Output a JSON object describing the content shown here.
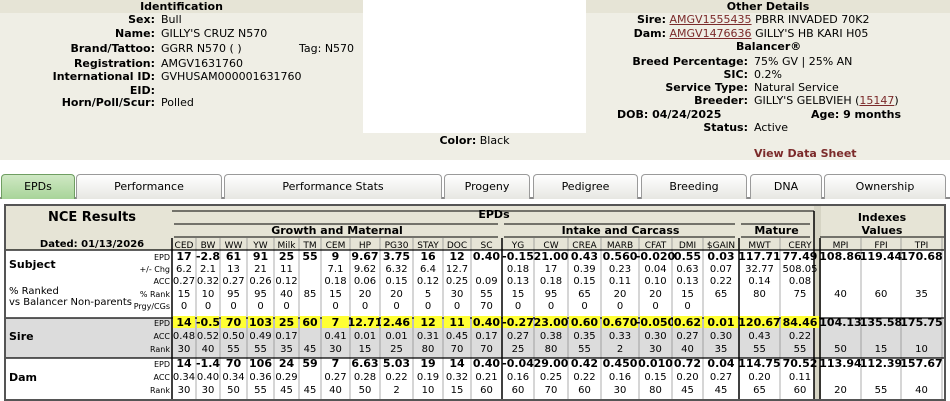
{
  "identification": {
    "title": "Identification",
    "rows": [
      {
        "label": "Sex:",
        "value": "Bull"
      },
      {
        "label": "Name:",
        "value": "GILLY'S CRUZ N570"
      },
      {
        "label": "Brand/Tattoo:",
        "value": "GGRR N570 ( )"
      },
      {
        "label": "Registration:",
        "value": "AMGV1631760"
      },
      {
        "label": "International ID:",
        "value": "GVHUSAM000001631760"
      },
      {
        "label": "EID:",
        "value": ""
      },
      {
        "label": "Horn/Poll/Scur:",
        "value": "Polled"
      }
    ],
    "tag_label": "Tag:",
    "tag_value": "N570",
    "color_label": "Color:",
    "color_value": "Black"
  },
  "other": {
    "title": "Other Details",
    "sire_label": "Sire:",
    "sire_reg": "AMGV1555435",
    "sire_name": "PBRR INVADED 70K2",
    "dam_label": "Dam:",
    "dam_reg": "AMGV1476636",
    "dam_name": "GILLY'S HB KARI H05",
    "balancer": "Balancer®",
    "breed_label": "Breed Percentage:",
    "breed_value": "75% GV | 25% AN",
    "sic_label": "SIC:",
    "sic_value": "0.2%",
    "service_label": "Service Type:",
    "service_value": "Natural Service",
    "breeder_label": "Breeder:",
    "breeder_value": "GILLY'S GELBVIEH (",
    "breeder_id": "15147",
    "breeder_close": ")",
    "dob_text": "DOB: 04/24/2025",
    "age_text": "Age: 9 months",
    "status_label": "Status:",
    "status_value": "Active",
    "view_data_sheet": "View Data Sheet"
  },
  "tabs": [
    "EPDs",
    "Performance",
    "Performance Stats",
    "Progeny",
    "Pedigree",
    "Breeding",
    "DNA",
    "Ownership"
  ],
  "epd": {
    "title": "NCE Results",
    "dated": "Dated: 01/13/2026",
    "epds_header": "EPDs",
    "groups": [
      "Growth and Maternal",
      "Intake and Carcass",
      "Mature"
    ],
    "indexes_header": [
      "Indexes",
      "Values"
    ],
    "cols": [
      "CED",
      "BW",
      "WW",
      "YW",
      "Milk",
      "TM",
      "CEM",
      "HP",
      "PG30",
      "STAY",
      "DOC",
      "SC",
      "YG",
      "CW",
      "CREA",
      "MARB",
      "CFAT",
      "DMI",
      "$GAIN",
      "MWT",
      "CERY",
      "MPI",
      "FPI",
      "TPI"
    ],
    "rows": [
      {
        "name": "Subject",
        "sub": [
          "% Ranked",
          "vs Balancer Non-parents"
        ],
        "labels": [
          "EPD",
          "+/- Chg",
          "ACC",
          "% Rank",
          "Prgy/CGs"
        ],
        "lines": [
          [
            "17",
            "-2.8",
            "61",
            "91",
            "25",
            "55",
            "9",
            "9.67",
            "3.75",
            "16",
            "12",
            "0.40",
            "-0.15",
            "21.00",
            "0.43",
            "0.560",
            "-0.020",
            "0.55",
            "0.03",
            "117.71",
            "77.49",
            "108.86",
            "119.44",
            "170.68"
          ],
          [
            "6.2",
            "2.1",
            "13",
            "21",
            "11",
            "",
            "7.1",
            "9.62",
            "6.32",
            "6.4",
            "12.7",
            "",
            "0.18",
            "17",
            "0.39",
            "0.23",
            "0.04",
            "0.63",
            "0.07",
            "32.77",
            "508.05",
            "",
            "",
            ""
          ],
          [
            "0.27",
            "0.32",
            "0.27",
            "0.26",
            "0.12",
            "",
            "0.18",
            "0.06",
            "0.15",
            "0.12",
            "0.25",
            "0.09",
            "0.13",
            "0.18",
            "0.15",
            "0.11",
            "0.10",
            "0.13",
            "0.22",
            "0.14",
            "0.08",
            "",
            "",
            ""
          ],
          [
            "15",
            "10",
            "95",
            "95",
            "40",
            "85",
            "15",
            "20",
            "20",
            "5",
            "30",
            "55",
            "15",
            "95",
            "65",
            "20",
            "20",
            "15",
            "65",
            "80",
            "75",
            "40",
            "60",
            "35"
          ],
          [
            "0",
            "0",
            "0",
            "0",
            "0",
            "",
            "0",
            "0",
            "0",
            "0",
            "0",
            "70",
            "0",
            "0",
            "0",
            "0",
            "0",
            "0",
            "",
            "",
            "",
            "",
            "",
            ""
          ]
        ]
      },
      {
        "name": "Sire",
        "sub": [],
        "labels": [
          "EPD",
          "ACC",
          "Rank"
        ],
        "lines": [
          [
            "14",
            "-0.5",
            "70",
            "103",
            "25",
            "60",
            "7",
            "12.71",
            "2.46",
            "12",
            "11",
            "0.40",
            "-0.27",
            "23.00",
            "0.60",
            "0.670",
            "-0.050",
            "0.62",
            "0.01",
            "120.67",
            "84.46",
            "104.13",
            "135.58",
            "175.75"
          ],
          [
            "0.48",
            "0.52",
            "0.50",
            "0.49",
            "0.17",
            "",
            "0.41",
            "0.01",
            "0.01",
            "0.31",
            "0.45",
            "0.17",
            "0.27",
            "0.38",
            "0.35",
            "0.33",
            "0.30",
            "0.27",
            "0.30",
            "0.43",
            "0.22",
            "",
            "",
            ""
          ],
          [
            "30",
            "40",
            "55",
            "55",
            "35",
            "45",
            "30",
            "15",
            "25",
            "80",
            "70",
            "70",
            "25",
            "80",
            "55",
            "2",
            "30",
            "40",
            "35",
            "55",
            "55",
            "50",
            "15",
            "10"
          ]
        ]
      },
      {
        "name": "Dam",
        "sub": [],
        "labels": [
          "EPD",
          "ACC",
          "Rank"
        ],
        "lines": [
          [
            "14",
            "-1.4",
            "70",
            "106",
            "24",
            "59",
            "7",
            "6.63",
            "5.03",
            "19",
            "14",
            "0.40",
            "-0.04",
            "29.00",
            "0.42",
            "0.450",
            "0.010",
            "0.72",
            "0.04",
            "114.75",
            "70.52",
            "113.94",
            "112.39",
            "157.67"
          ],
          [
            "0.34",
            "0.40",
            "0.34",
            "0.36",
            "0.29",
            "",
            "0.27",
            "0.28",
            "0.22",
            "0.19",
            "0.32",
            "0.21",
            "0.16",
            "0.25",
            "0.22",
            "0.16",
            "0.15",
            "0.20",
            "0.27",
            "0.20",
            "0.11",
            "",
            "",
            ""
          ],
          [
            "30",
            "30",
            "50",
            "55",
            "45",
            "45",
            "40",
            "50",
            "2",
            "10",
            "15",
            "60",
            "60",
            "70",
            "60",
            "30",
            "80",
            "45",
            "45",
            "65",
            "60",
            "20",
            "55",
            "40"
          ]
        ]
      }
    ]
  },
  "colors": {
    "panel": "#efeee5",
    "header": "#e6e4d6",
    "highlight": "#ffff33",
    "link": "#7b2a2a",
    "active_tab": "#b8dca8"
  }
}
